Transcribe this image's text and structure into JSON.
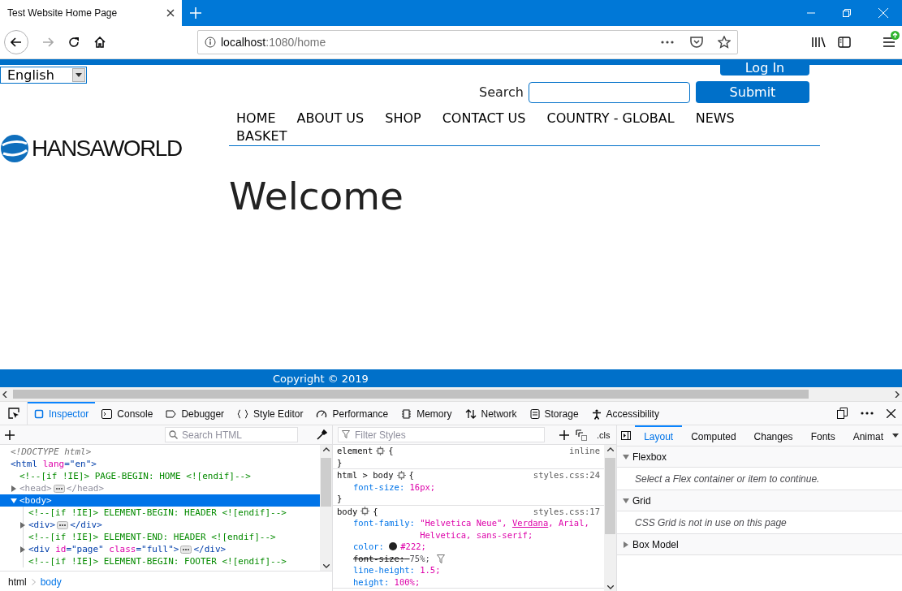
{
  "browser": {
    "tab_title": "Test Website Home Page",
    "url_host": "localhost",
    "url_path": ":1080/home"
  },
  "page": {
    "language": "English",
    "login": "Log In",
    "search_label": "Search",
    "submit": "Submit",
    "nav": [
      {
        "label": "HOME"
      },
      {
        "label": "ABOUT US"
      },
      {
        "label": "SHOP"
      },
      {
        "label": "CONTACT US"
      },
      {
        "label": "COUNTRY - GLOBAL"
      },
      {
        "label": "NEWS"
      },
      {
        "label": "BASKET"
      }
    ],
    "logo": "HANSAWORLD",
    "heading": "Welcome",
    "footer": "Copyright © 2019"
  },
  "devtools": {
    "tabs": [
      {
        "label": "Inspector",
        "kind": "inspector",
        "selected": true
      },
      {
        "label": "Console",
        "kind": "console",
        "selected": false
      },
      {
        "label": "Debugger",
        "kind": "debugger",
        "selected": false
      },
      {
        "label": "Style Editor",
        "kind": "braces",
        "selected": false
      },
      {
        "label": "Performance",
        "kind": "gauge",
        "selected": false
      },
      {
        "label": "Memory",
        "kind": "chip",
        "selected": false
      },
      {
        "label": "Network",
        "kind": "arrows",
        "selected": false
      },
      {
        "label": "Storage",
        "kind": "storage",
        "selected": false
      },
      {
        "label": "Accessibility",
        "kind": "person",
        "selected": false
      }
    ],
    "markup_search": {
      "placeholder": "Search HTML"
    },
    "markup": [
      {
        "tokens": [
          {
            "kind": "doctype",
            "text": "<!DOCTYPE html>"
          }
        ],
        "selected": false
      },
      {
        "tokens": [
          {
            "kind": "tag",
            "text": "<html "
          },
          {
            "kind": "attr",
            "text": "lang"
          },
          {
            "kind": "tag",
            "text": "=\"en\">"
          }
        ],
        "selected": false,
        "children": [
          {
            "tokens": [
              {
                "kind": "comment",
                "text": "<!--[if !IE]> PAGE-BEGIN: HOME <![endif]-->"
              }
            ],
            "selected": false
          },
          {
            "tokens": [
              {
                "kind": "dim",
                "text": "<head>"
              }
            ],
            "closing": [
              {
                "kind": "dim",
                "text": "</head>"
              }
            ],
            "expanded": false,
            "selected": false
          },
          {
            "tokens": [
              {
                "kind": "tag",
                "text": "<body>"
              }
            ],
            "expanded": true,
            "selected": true,
            "children": [
              {
                "tokens": [
                  {
                    "kind": "comment",
                    "text": "<!--[if !IE]> ELEMENT-BEGIN: HEADER <![endif]-->"
                  }
                ],
                "selected": false
              },
              {
                "tokens": [
                  {
                    "kind": "tag",
                    "text": "<div>"
                  }
                ],
                "closing": [
                  {
                    "kind": "tag",
                    "text": "</div>"
                  }
                ],
                "expanded": false,
                "selected": false
              },
              {
                "tokens": [
                  {
                    "kind": "comment",
                    "text": "<!--[if !IE]> ELEMENT-END: HEADER <![endif]-->"
                  }
                ],
                "selected": false
              },
              {
                "tokens": [
                  {
                    "kind": "tag",
                    "text": "<div "
                  },
                  {
                    "kind": "attr",
                    "text": "id"
                  },
                  {
                    "kind": "tag",
                    "text": "=\"page\" "
                  },
                  {
                    "kind": "attr",
                    "text": "class"
                  },
                  {
                    "kind": "tag",
                    "text": "=\"full\">"
                  }
                ],
                "closing": [
                  {
                    "kind": "tag",
                    "text": "</div>"
                  }
                ],
                "expanded": false,
                "selected": false
              },
              {
                "tokens": [
                  {
                    "kind": "comment",
                    "text": "<!--[if !IE]> ELEMENT-BEGIN: FOOTER <![endif]-->"
                  }
                ],
                "selected": false
              }
            ]
          }
        ]
      }
    ],
    "breadcrumbs": [
      {
        "label": "html",
        "selected": false
      },
      {
        "label": "body",
        "selected": true
      }
    ],
    "styles_filter": {
      "placeholder": "Filter Styles"
    },
    "cls": ".cls",
    "rules": [
      {
        "selector": "element",
        "open": "{",
        "source": "inline",
        "close": "}"
      },
      {
        "selector": "html > body",
        "open": "{",
        "source": "styles.css:24",
        "declarations": [
          {
            "property": "font-size:",
            "value": [
              {
                "text": "16px;",
                "matched": false
              }
            ],
            "overridden": false
          }
        ],
        "close": "}"
      },
      {
        "selector": "body",
        "open": "{",
        "source": "styles.css:17",
        "declarations": [
          {
            "property": "font-family:",
            "value": [
              {
                "text": "\"Helvetica Neue\", ",
                "matched": false
              },
              {
                "text": "Verdana",
                "matched": true
              },
              {
                "text": ", Arial, Helvetica, sans-serif;",
                "matched": false
              }
            ],
            "overridden": false
          },
          {
            "property": "color:",
            "color": "#222222",
            "value": [
              {
                "text": "#222;",
                "matched": false
              }
            ],
            "overridden": false
          },
          {
            "property": "font-size:",
            "value": [
              {
                "text": "75%;",
                "matched": false
              }
            ],
            "overridden": true
          },
          {
            "property": "line-height:",
            "value": [
              {
                "text": "1.5;",
                "matched": false
              }
            ],
            "overridden": false
          },
          {
            "property": "height:",
            "value": [
              {
                "text": "100%;",
                "matched": false
              }
            ],
            "overridden": false
          }
        ]
      }
    ],
    "sidebar_tabs": [
      {
        "label": "Layout",
        "selected": true
      },
      {
        "label": "Computed",
        "selected": false
      },
      {
        "label": "Changes",
        "selected": false
      },
      {
        "label": "Fonts",
        "selected": false
      },
      {
        "label": "Animat",
        "selected": false
      }
    ],
    "layout_sections": [
      {
        "title": "Flexbox",
        "expanded": true,
        "message": "Select a Flex container or item to continue."
      },
      {
        "title": "Grid",
        "expanded": true,
        "message": "CSS Grid is not in use on this page"
      },
      {
        "title": "Box Model",
        "expanded": false
      }
    ]
  }
}
